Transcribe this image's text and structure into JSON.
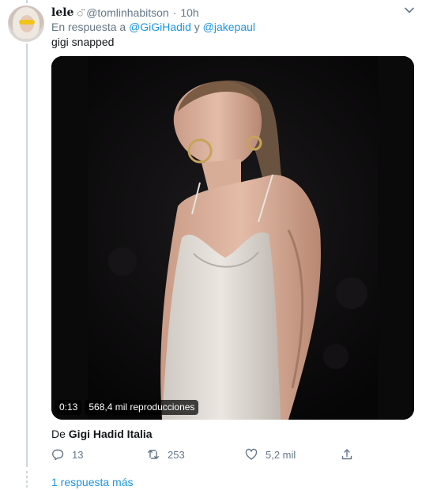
{
  "tweet": {
    "name": "lele",
    "name_decoration": "◌̈",
    "handle": "@tomlinhabitson",
    "separator": "·",
    "time": "10h",
    "reply_prefix": "En respuesta a",
    "mention_1": "@GiGiHadid",
    "reply_joiner": "y",
    "mention_2": "@jakepaul",
    "text": "gigi snapped"
  },
  "video": {
    "duration": "0:13",
    "views": "568,4 mil reproducciones"
  },
  "source": {
    "prefix": "De",
    "account": "Gigi Hadid Italia"
  },
  "actions": {
    "replies": "13",
    "retweets": "253",
    "likes": "5,2 mil"
  },
  "thread": {
    "more_replies": "1 respuesta más"
  },
  "icons": [
    "avatar",
    "caret-down-icon",
    "reply-icon",
    "retweet-icon",
    "like-icon",
    "share-icon"
  ],
  "colors": {
    "link": "#1b95e0",
    "muted": "#657786",
    "text": "#14171a",
    "thread_line": "#ccd6dd"
  }
}
